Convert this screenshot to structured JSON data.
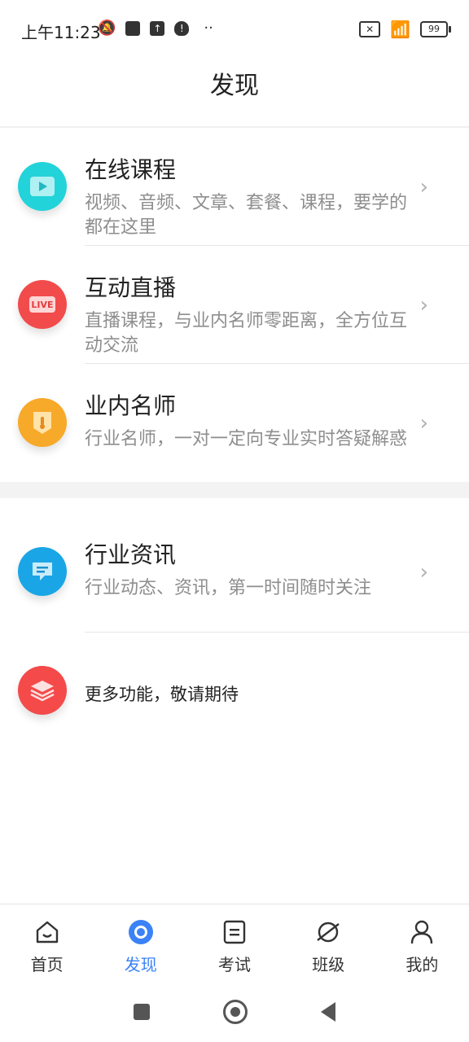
{
  "status": {
    "time": "上午11:23",
    "battery": "99"
  },
  "header": {
    "title": "发现"
  },
  "items": [
    {
      "title": "在线课程",
      "desc": "视频、音频、文章、套餐、课程，要学的都在这里",
      "icon": "play-icon",
      "color": "#22d3d9"
    },
    {
      "title": "互动直播",
      "desc": "直播课程，与业内名师零距离，全方位互动交流",
      "icon": "live-icon",
      "color": "#f24b4b",
      "badge": "LIVE"
    },
    {
      "title": "业内名师",
      "desc": "行业名师，一对一定向专业实时答疑解惑",
      "icon": "badge-icon",
      "color": "#f7a92a"
    },
    {
      "title": "行业资讯",
      "desc": "行业动态、资讯，第一时间随时关注",
      "icon": "message-icon",
      "color": "#1aa6e6"
    }
  ],
  "more": {
    "text": "更多功能，敬请期待",
    "icon": "layers-icon",
    "color": "#f44a4a"
  },
  "tabs": [
    {
      "label": "首页",
      "icon": "home-icon"
    },
    {
      "label": "发现",
      "icon": "discover-icon"
    },
    {
      "label": "考试",
      "icon": "exam-icon"
    },
    {
      "label": "班级",
      "icon": "class-icon"
    },
    {
      "label": "我的",
      "icon": "profile-icon"
    }
  ]
}
